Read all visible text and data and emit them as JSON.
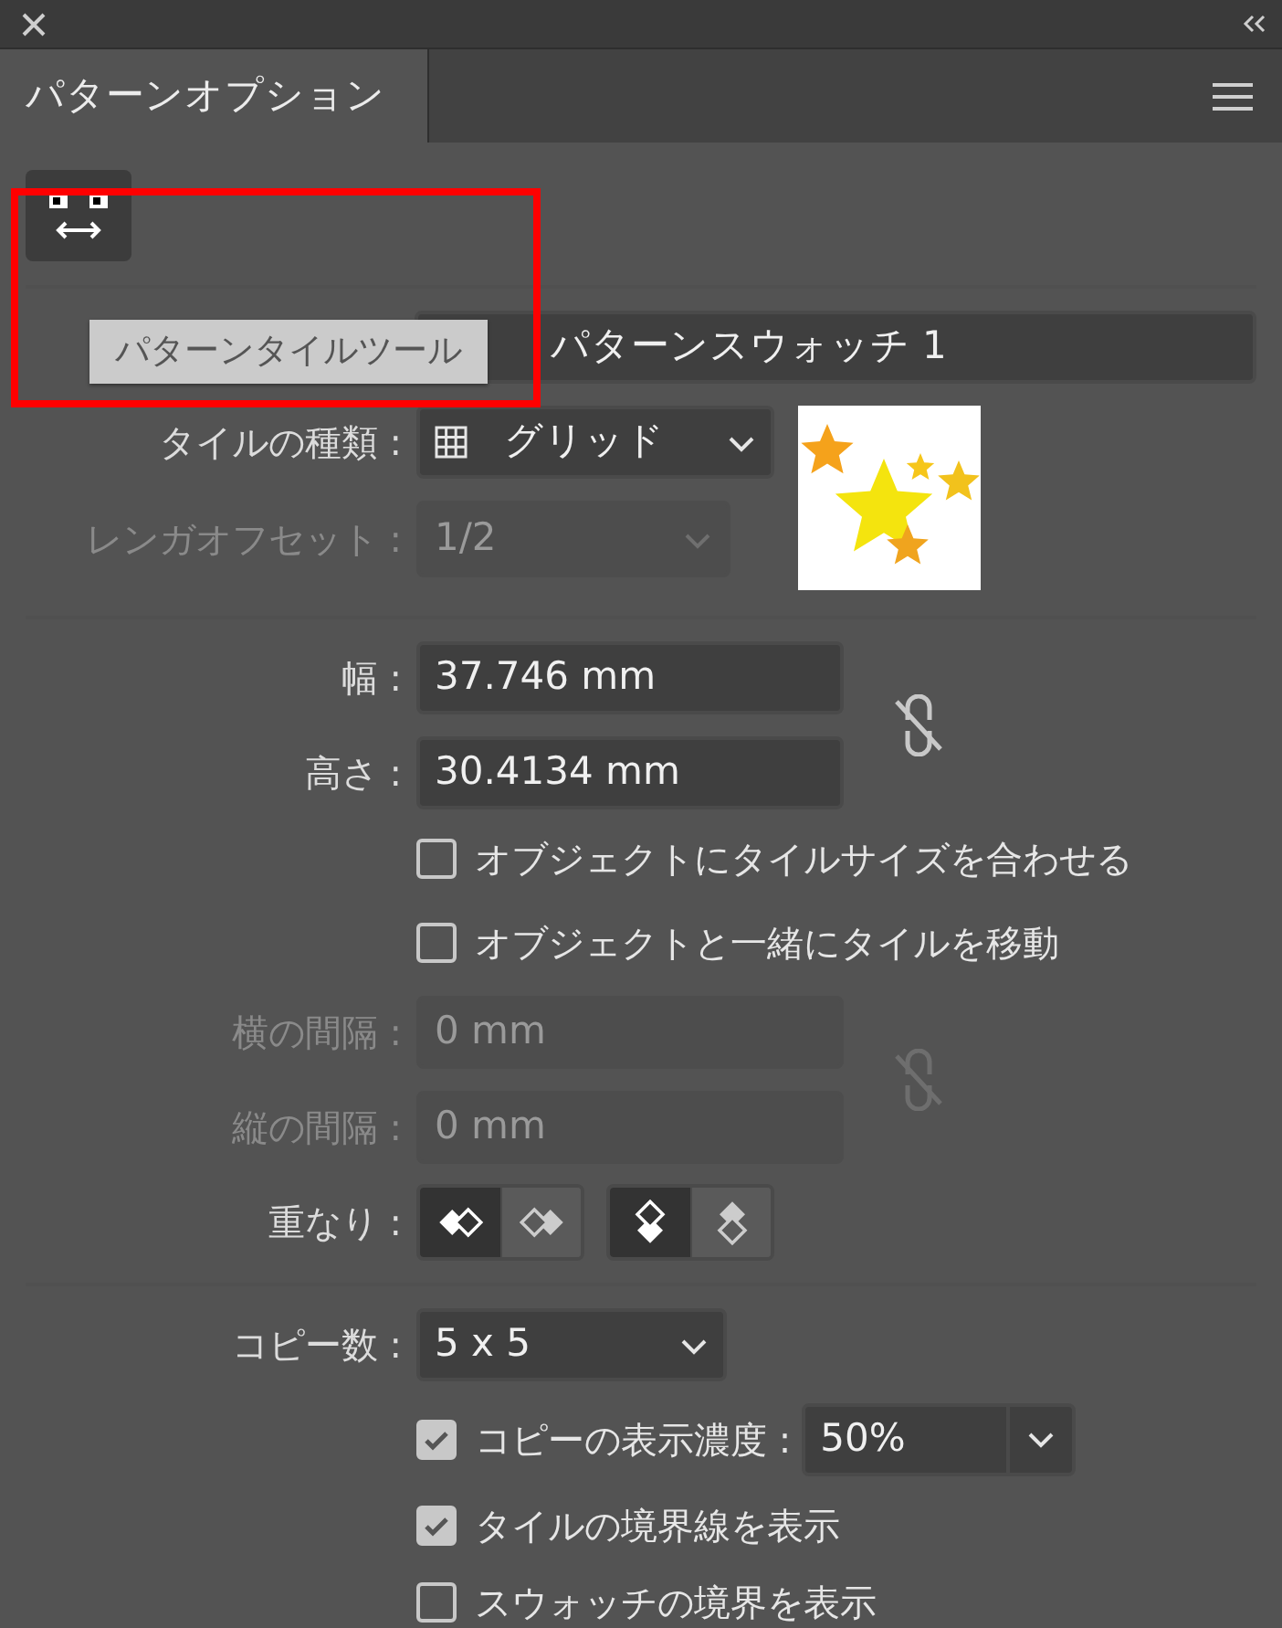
{
  "window": {
    "tab": {
      "label": "パターンオプション",
      "selected": true
    }
  },
  "tool": {
    "tooltip": "パターンタイルツール",
    "pressed": true
  },
  "annotation": {
    "kind": "highlight-frame"
  },
  "name": {
    "value": "パターンスウォッチ 1"
  },
  "tile_type": {
    "label": "タイルの種類 :",
    "value": "グリッド",
    "disabled": false
  },
  "brick_offset": {
    "label": "レンガオフセット :",
    "value": "1/2",
    "disabled": true
  },
  "size": {
    "linked": false,
    "fields": [
      {
        "label": "幅 :",
        "value": "37.746 mm",
        "disabled": false
      },
      {
        "label": "高さ :",
        "value": "30.4134 mm",
        "disabled": false
      }
    ]
  },
  "size_options": [
    {
      "label": "オブジェクトにタイルサイズを合わせる",
      "checked": false
    },
    {
      "label": "オブジェクトと一緒にタイルを移動",
      "checked": false
    }
  ],
  "spacing": {
    "linked": false,
    "fields": [
      {
        "label": "横の間隔 :",
        "value": "0 mm",
        "disabled": true
      },
      {
        "label": "縦の間隔 :",
        "value": "0 mm",
        "disabled": true
      }
    ]
  },
  "overlap": {
    "label": "重なり :",
    "groups": [
      [
        {
          "kind": "left-front",
          "selected": true
        },
        {
          "kind": "right-front",
          "selected": false
        }
      ],
      [
        {
          "kind": "top-front",
          "selected": true
        },
        {
          "kind": "bottom-front",
          "selected": false
        }
      ]
    ]
  },
  "copies": {
    "label": "コピー数 :",
    "value": "5 x 5"
  },
  "dim_copies": {
    "label": "コピーの表示濃度 :",
    "checked": true,
    "value": "50%"
  },
  "display_options": [
    {
      "label": "タイルの境界線を表示",
      "checked": true
    },
    {
      "label": "スウォッチの境界を表示",
      "checked": false
    }
  ]
}
